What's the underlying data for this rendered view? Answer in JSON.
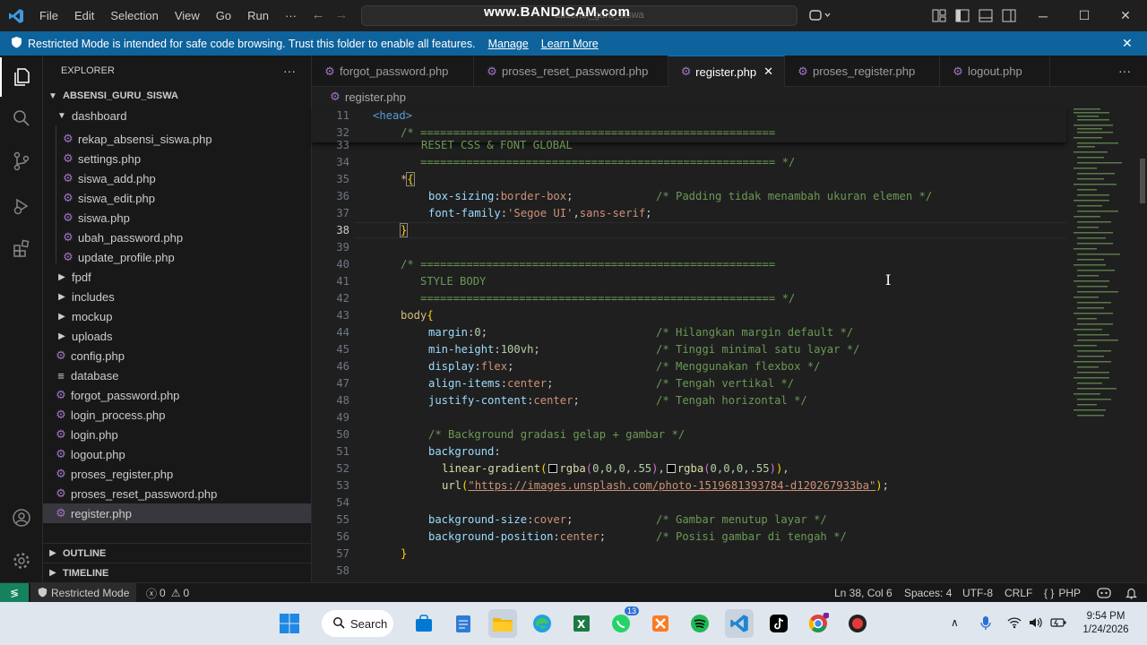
{
  "titlebar": {
    "menu": [
      "File",
      "Edit",
      "Selection",
      "View",
      "Go",
      "Run",
      "···"
    ],
    "watermark": "www.BANDICAM.com",
    "search_text": "absensi_guru_siswa"
  },
  "banner": {
    "message": "Restricted Mode is intended for safe code browsing. Trust this folder to enable all features.",
    "manage": "Manage",
    "learn_more": "Learn More"
  },
  "sidebar": {
    "header": "EXPLORER",
    "root": "ABSENSI_GURU_SISWA",
    "folder": "dashboard",
    "dashboard_files": [
      "rekap_absensi_siswa.php",
      "settings.php",
      "siswa_add.php",
      "siswa_edit.php",
      "siswa.php",
      "ubah_password.php",
      "update_profile.php"
    ],
    "folders": [
      "fpdf",
      "includes",
      "mockup",
      "uploads"
    ],
    "root_files": [
      {
        "name": "config.php",
        "icon": "php-icon"
      },
      {
        "name": "database",
        "icon": "file-lines-icon"
      },
      {
        "name": "forgot_password.php",
        "icon": "php-icon"
      },
      {
        "name": "login_process.php",
        "icon": "php-icon"
      },
      {
        "name": "login.php",
        "icon": "php-icon"
      },
      {
        "name": "logout.php",
        "icon": "php-icon"
      },
      {
        "name": "proses_register.php",
        "icon": "php-icon"
      },
      {
        "name": "proses_reset_password.php",
        "icon": "php-icon"
      },
      {
        "name": "register.php",
        "icon": "php-icon"
      }
    ],
    "outline": "OUTLINE",
    "timeline": "TIMELINE"
  },
  "tabs": [
    "forgot_password.php",
    "proses_reset_password.php",
    "register.php",
    "proses_register.php",
    "logout.php"
  ],
  "active_tab": "register.php",
  "breadcrumb": "register.php",
  "sticky": {
    "l11": "11",
    "l11_text": "<head>",
    "l32": "32",
    "l32_text": "/* ======================================================"
  },
  "lines": {
    "n33": "33",
    "t33": "RESET CSS & FONT GLOBAL",
    "n34": "34",
    "t34": "   ====================================================== */",
    "n35": "35",
    "t35_sel": "*",
    "t35_brace": "{",
    "n36": "36",
    "t36_prop": "box-sizing",
    "t36_val": "border-box",
    "t36_com": "/* Padding tidak menambah ukuran elemen */",
    "n37": "37",
    "t37_prop": "font-family",
    "t37_val1": "'Segoe UI'",
    "t37_val2": "sans-serif",
    "n38": "38",
    "t38": "}",
    "n39": "39",
    "n40": "40",
    "t40": "/* ======================================================",
    "n41": "41",
    "t41": "   STYLE BODY",
    "n42": "42",
    "t42": "   ====================================================== */",
    "n43": "43",
    "t43_sel": "body",
    "t43_brace": "{",
    "n44": "44",
    "t44_prop": "margin",
    "t44_val": "0",
    "t44_com": "/* Hilangkan margin default */",
    "n45": "45",
    "t45_prop": "min-height",
    "t45_val": "100vh",
    "t45_com": "/* Tinggi minimal satu layar */",
    "n46": "46",
    "t46_prop": "display",
    "t46_val": "flex",
    "t46_com": "/* Menggunakan flexbox */",
    "n47": "47",
    "t47_prop": "align-items",
    "t47_val": "center",
    "t47_com": "/* Tengah vertikal */",
    "n48": "48",
    "t48_prop": "justify-content",
    "t48_val": "center",
    "t48_com": "/* Tengah horizontal */",
    "n49": "49",
    "n50": "50",
    "t50": "/* Background gradasi gelap + gambar */",
    "n51": "51",
    "t51_prop": "background",
    "n52": "52",
    "t52_fn": "linear-gradient",
    "t52_a": "rgba",
    "t52_args": "0,0,0,.55",
    "t52_b": "rgba",
    "t52_args2": "0,0,0,.55",
    "n53": "53",
    "t53_fn": "url",
    "t53_val": "\"https://images.unsplash.com/photo-1519681393784-d120267933ba\"",
    "n54": "54",
    "n55": "55",
    "t55_prop": "background-size",
    "t55_val": "cover",
    "t55_com": "/* Gambar menutup layar */",
    "n56": "56",
    "t56_prop": "background-position",
    "t56_val": "center",
    "t56_com": "/* Posisi gambar di tengah */",
    "n57": "57",
    "t57": "}",
    "n58": "58"
  },
  "statusbar": {
    "restricted": "Restricted Mode",
    "errors": "0",
    "warnings": "0",
    "position": "Ln 38, Col 6",
    "spaces": "Spaces: 4",
    "encoding": "UTF-8",
    "eol": "CRLF",
    "language": "PHP"
  },
  "taskbar": {
    "search": "Search",
    "whatsapp_badge": "13",
    "time": "9:54 PM",
    "date": "1/24/2026"
  },
  "colors": {
    "accent": "#0078d4",
    "banner": "#0e639c",
    "comment": "#6a9955",
    "property": "#9cdcfe",
    "string": "#ce9178"
  }
}
